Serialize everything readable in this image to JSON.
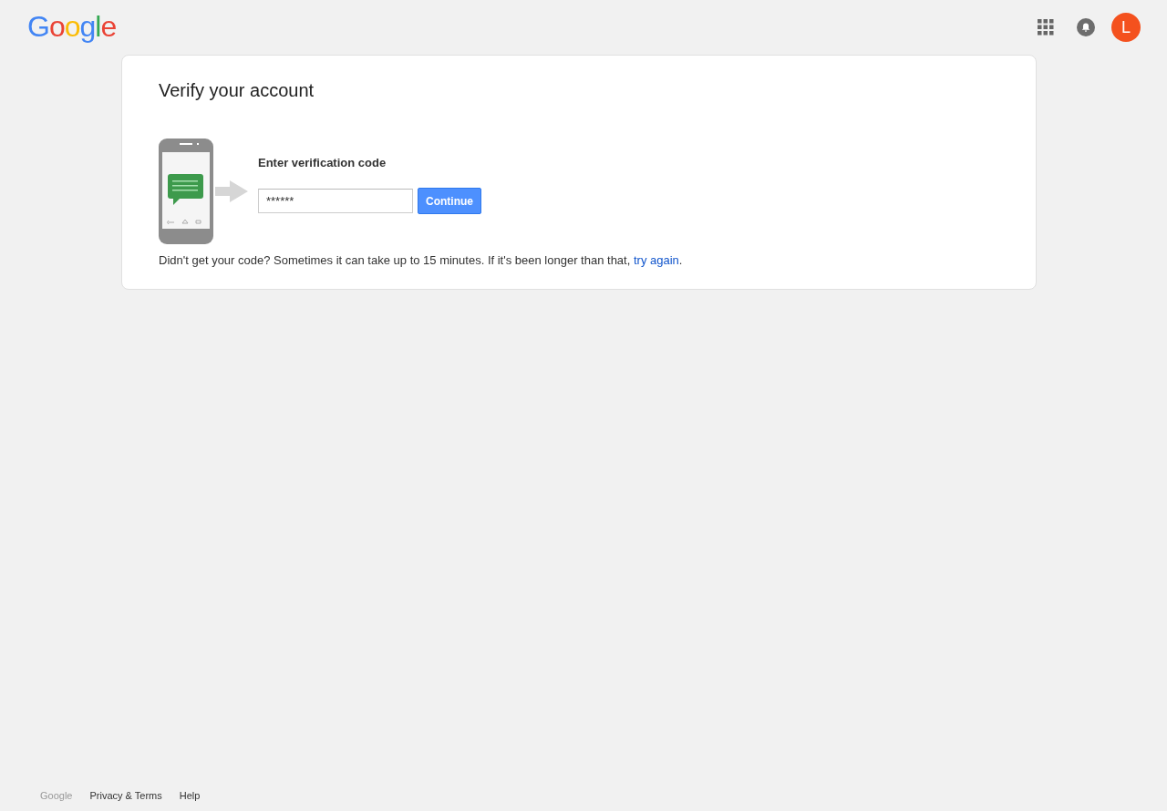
{
  "header": {
    "logo": "Google",
    "avatar_letter": "L"
  },
  "card": {
    "title": "Verify your account",
    "field_label": "Enter verification code",
    "code_field": {
      "value": "******"
    },
    "button": "Continue",
    "hint": {
      "text_before": "Didn't get your code? Sometimes it can take up to 15 minutes. If it's been longer than that, ",
      "link": "try again",
      "text_after": "."
    }
  },
  "footer": {
    "brand": "Google",
    "links": [
      "Privacy & Terms",
      "Help"
    ]
  }
}
